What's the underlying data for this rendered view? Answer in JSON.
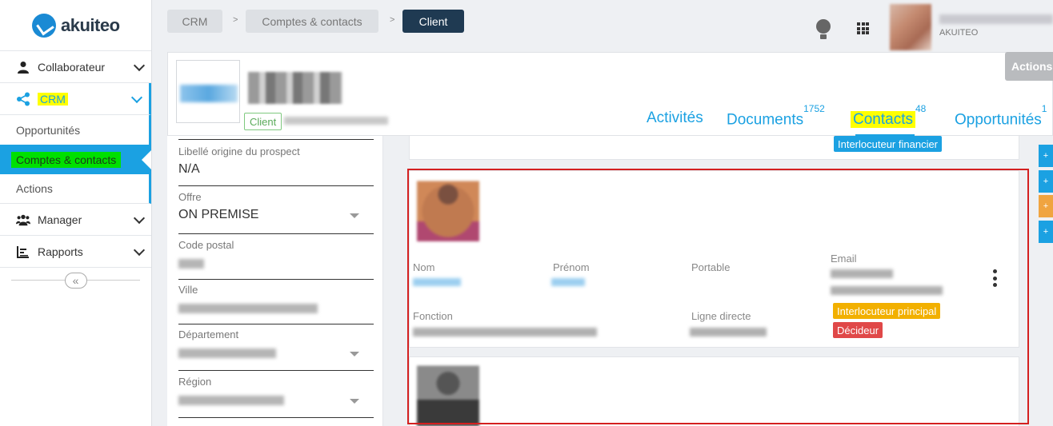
{
  "sidebar": {
    "brand": "akuiteo",
    "items": [
      {
        "label": "Collaborateur",
        "icon": "user-icon"
      },
      {
        "label": "CRM",
        "icon": "share-icon"
      },
      {
        "label": "Manager",
        "icon": "users-icon"
      },
      {
        "label": "Rapports",
        "icon": "chart-icon"
      }
    ],
    "crm_sub": [
      "Opportunités",
      "Comptes & contacts",
      "Actions"
    ],
    "collapse_glyph": "«"
  },
  "breadcrumb": {
    "items": [
      "CRM",
      "Comptes & contacts",
      "Client"
    ],
    "separator": ">"
  },
  "topbar": {
    "company": "AKUITEO"
  },
  "client": {
    "type_badge": "Client",
    "actions_label": "Actions"
  },
  "tabs": [
    {
      "label": "Activités",
      "count": ""
    },
    {
      "label": "Documents",
      "count": "1752"
    },
    {
      "label": "Contacts",
      "count": "48"
    },
    {
      "label": "Opportunités",
      "count": "1"
    }
  ],
  "form": {
    "origine_label": "Libellé origine du prospect",
    "origine_value": "N/A",
    "offre_label": "Offre",
    "offre_value": "ON PREMISE",
    "code_postal_label": "Code postal",
    "ville_label": "Ville",
    "departement_label": "Département",
    "region_label": "Région"
  },
  "contacts": {
    "prev_badge": "Interlocuteur financier",
    "nom_label": "Nom",
    "prenom_label": "Prénom",
    "portable_label": "Portable",
    "email_label": "Email",
    "fonction_label": "Fonction",
    "ligne_label": "Ligne directe",
    "badge_principal": "Interlocuteur principal",
    "badge_decideur": "Décideur"
  },
  "side_buttons": [
    "+",
    "+",
    "+",
    "+"
  ],
  "colors": {
    "accent": "#1ba1e2",
    "dark_crumb": "#1f3a52",
    "highlight_yellow": "#ffff00",
    "highlight_green": "#00e000",
    "badge_orange": "#f2b000",
    "badge_red": "#e04848",
    "frame_red": "#d42020"
  }
}
